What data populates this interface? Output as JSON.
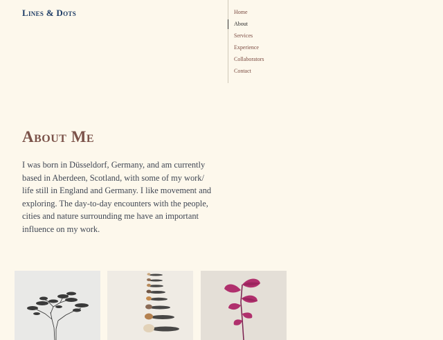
{
  "site": {
    "title": "Lines & Dots"
  },
  "nav": {
    "items": [
      {
        "label": "Home",
        "active": false
      },
      {
        "label": "About",
        "active": true
      },
      {
        "label": "Services",
        "active": false
      },
      {
        "label": "Experience",
        "active": false
      },
      {
        "label": "Collaborators",
        "active": false
      },
      {
        "label": "Contact",
        "active": false
      }
    ]
  },
  "about": {
    "heading": "About Me",
    "body": "I was born in Düsseldorf, Germany, and am currently based in Aberdeen, Scotland, with some of my work/ life still in England and Germany. I like movement and exploring. The day-to-day encounters with the people, cities and nature surrounding me have an important influence on my work."
  },
  "gallery": [
    {
      "image": "tree-sketch-drawing"
    },
    {
      "image": "row-of-pebbles"
    },
    {
      "image": "pink-leaf-plant"
    }
  ],
  "colors": {
    "background": "#fdf8ec",
    "title": "#1f3d66",
    "nav_link": "#7a4a40",
    "heading": "#7b5249",
    "body_text": "#3f4653"
  }
}
